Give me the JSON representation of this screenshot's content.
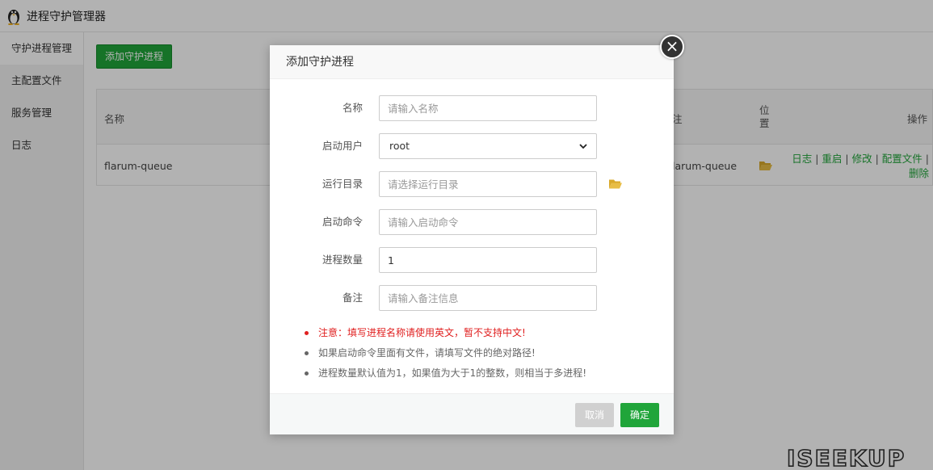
{
  "app": {
    "title": "进程守护管理器"
  },
  "sidebar": {
    "items": [
      {
        "label": "守护进程管理",
        "active": true
      },
      {
        "label": "主配置文件",
        "active": false
      },
      {
        "label": "服务管理",
        "active": false
      },
      {
        "label": "日志",
        "active": false
      }
    ]
  },
  "main": {
    "add_button": "添加守护进程",
    "table": {
      "headers": {
        "name": "名称",
        "note": "注",
        "position": "位置",
        "operations": "操作"
      },
      "rows": [
        {
          "name": "flarum-queue",
          "note": "larum-queue",
          "actions": [
            "日志",
            "重启",
            "修改",
            "配置文件",
            "删除"
          ]
        }
      ]
    }
  },
  "modal": {
    "title": "添加守护进程",
    "fields": {
      "name": {
        "label": "名称",
        "placeholder": "请输入名称",
        "value": ""
      },
      "user": {
        "label": "启动用户",
        "value": "root"
      },
      "dir": {
        "label": "运行目录",
        "placeholder": "请选择运行目录",
        "value": ""
      },
      "command": {
        "label": "启动命令",
        "placeholder": "请输入启动命令",
        "value": ""
      },
      "count": {
        "label": "进程数量",
        "value": "1"
      },
      "note": {
        "label": "备注",
        "placeholder": "请输入备注信息",
        "value": ""
      }
    },
    "tips": [
      {
        "text": "注意：填写进程名称请使用英文，暂不支持中文!",
        "level": "warning"
      },
      {
        "text": "如果启动命令里面有文件，请填写文件的绝对路径!",
        "level": "info"
      },
      {
        "text": "进程数量默认值为1，如果值为大于1的整数，则相当于多进程!",
        "level": "info"
      }
    ],
    "cancel_label": "取消",
    "confirm_label": "确定"
  },
  "watermark": "ISEEKUP",
  "colors": {
    "accent": "#20a53a",
    "warning": "#e02020",
    "folder": "#d9a92b"
  }
}
